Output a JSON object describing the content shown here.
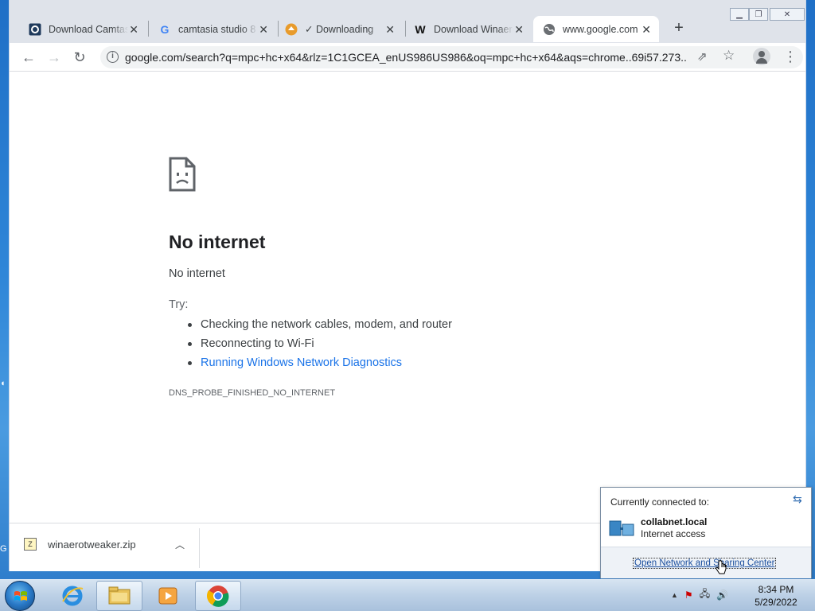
{
  "browser": {
    "tabs": [
      {
        "title": "Download Camtasia",
        "icon": "camtasia-icon",
        "active": false
      },
      {
        "title": "camtasia studio 8",
        "icon": "google-icon",
        "active": false
      },
      {
        "title": "✓ Downloading",
        "icon": "download-site-icon",
        "active": false
      },
      {
        "title": "Download Winaero",
        "icon": "winaero-icon",
        "active": false
      },
      {
        "title": "www.google.com",
        "icon": "globe-icon",
        "active": true
      }
    ],
    "url": "google.com/search?q=mpc+hc+x64&rlz=1C1GCEA_enUS986US986&oq=mpc+hc+x64&aqs=chrome..69i57.273..."
  },
  "error": {
    "title": "No internet",
    "subtitle": "No internet",
    "try_label": "Try:",
    "suggestions": [
      "Checking the network cables, modem, and router",
      "Reconnecting to Wi-Fi",
      "Running Windows Network Diagnostics"
    ],
    "code": "DNS_PROBE_FINISHED_NO_INTERNET"
  },
  "downloads": {
    "file": "winaerotweaker.zip"
  },
  "network_popup": {
    "header": "Currently connected to:",
    "network_name": "collabnet.local",
    "status": "Internet access",
    "link": "Open Network and Sharing Center"
  },
  "taskbar": {
    "time": "8:34 PM",
    "date": "5/29/2022"
  },
  "colors": {
    "link_blue": "#1a73e8",
    "desktop_blue": "#2f86d8"
  }
}
